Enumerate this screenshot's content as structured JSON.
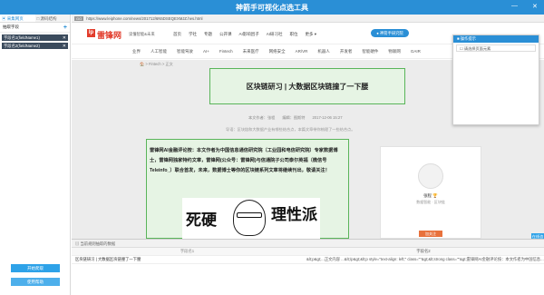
{
  "app": {
    "title": "神箭手可视化点选工具",
    "minimize": "—",
    "close": "✕"
  },
  "left_tabs": [
    {
      "label": "▣ 采集网页"
    },
    {
      "label": "□ 源码结构"
    }
  ],
  "fields_panel": {
    "header": "抽取字段",
    "add": "+",
    "items": [
      {
        "label": "字段名1(fieldName1)",
        "remove": "✕"
      },
      {
        "label": "字段名2(fieldName2)",
        "remove": "✕"
      }
    ]
  },
  "buttons": {
    "start": "开始爬取",
    "help": "使用帮助"
  },
  "urlbar": {
    "go": "GO",
    "url": "https://www.leiphone.com/news/201712/6N5DSEQEXMJZ.hes.html"
  },
  "site": {
    "logo_mark": "lp",
    "logo_text": "雷锋网",
    "slogan": "读懂智能&未来",
    "menu": [
      "首页",
      "学社",
      "专题",
      "公开课",
      "AI影响因子",
      "AI研习社",
      "职位",
      "更多 ▾"
    ],
    "cta": "● 神箭手研究院",
    "subnav": [
      "业界",
      "人工智能",
      "智能驾驶",
      "AI+",
      "Fintech",
      "未来医疗",
      "网络安全",
      "AR/VR",
      "机器人",
      "开发者",
      "智能硬件",
      "物联网",
      "GAIR"
    ],
    "breadcrumb": "🏠 > Fintech > 正文",
    "article_title": "区块链研习 | 大数据区块链撞了一下腰",
    "meta": [
      "本文作者：张程",
      "编辑：图斯特",
      "2017-12-06 15:27"
    ],
    "intro": "导语：区块链和大数据产业有哪些结合点，本篇文章带你梳理了一些结合点。",
    "body": "雷锋网AI金融评论按：本文作者为中国信息通信研究院（工业园和电信研究院）专家数据博士，雷锋网独家特约文章，雷锋网(公众号：雷锋网)与信通院子公司泰尔英福（微信号Teleinfo_）联合首发，未来，数据博士等你的区块链系列文章将继续刊出，敬请关注！",
    "art_words": [
      "死硬",
      "理性派"
    ],
    "author_name": "张程 🏆",
    "author_sub": "数据智能 · 区块链",
    "follow": "加关注"
  },
  "operations_panel": {
    "title": "■ 操作提示",
    "item": "☐ 请选择页面元素"
  },
  "fab": {
    "label": "在线咨询"
  },
  "data_table": {
    "title": "▤ 当前规则抽取的数据",
    "headers": [
      "字段名1",
      "字段名2"
    ],
    "rows": [
      [
        "区块链研习 | 大数据区块链撞了一下腰",
        "&lt;p&gt;...正文内容 ...&lt;/p&gt;&lt;p style=\"text-align: left;\" class=\"\"&gt;&lt;strong class=\"\"&gt;雷锋网AI金融评论按：本文作者为中国信息..."
      ]
    ]
  }
}
